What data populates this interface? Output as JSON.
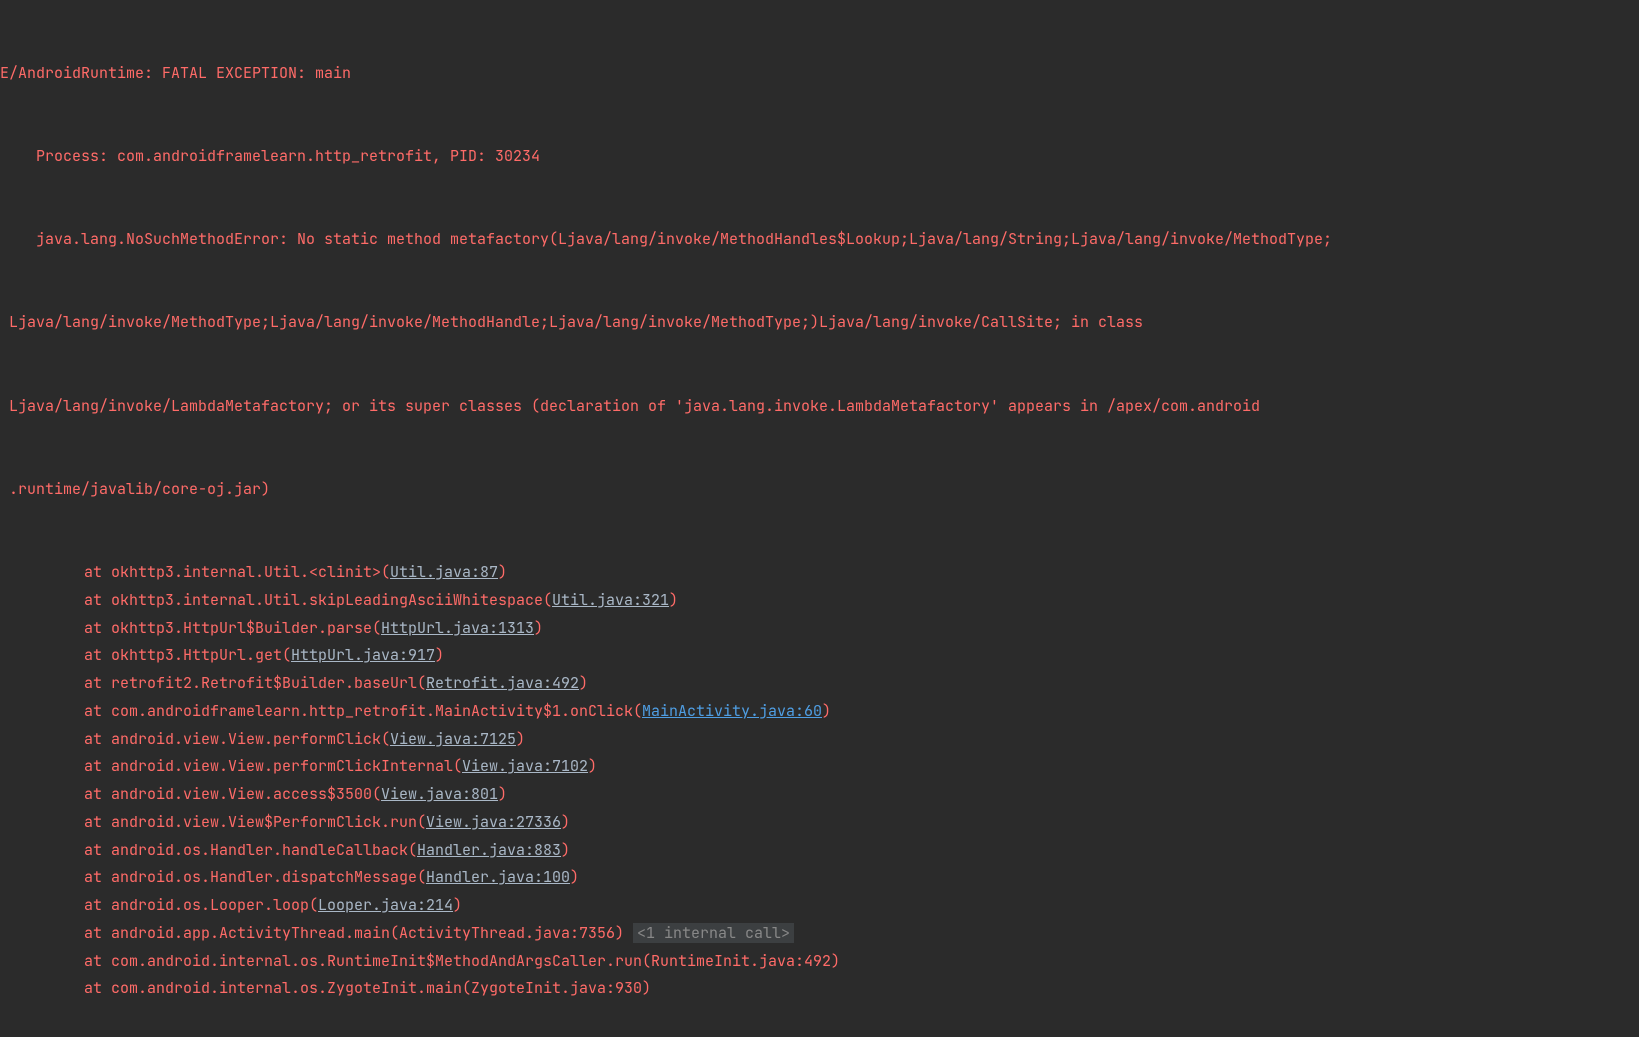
{
  "header": {
    "tag": "E/AndroidRuntime: FATAL EXCEPTION: main",
    "process": "    Process: com.androidframelearn.http_retrofit, PID: 30234",
    "msg1": "    java.lang.NoSuchMethodError: No static method metafactory(Ljava/lang/invoke/MethodHandles$Lookup;Ljava/lang/String;Ljava/lang/invoke/MethodType;",
    "msg2": " Ljava/lang/invoke/MethodType;Ljava/lang/invoke/MethodHandle;Ljava/lang/invoke/MethodType;)Ljava/lang/invoke/CallSite; in class ",
    "msg3": " Ljava/lang/invoke/LambdaMetafactory; or its super classes (declaration of 'java.lang.invoke.LambdaMetafactory' appears in /apex/com.android",
    "msg4": " .runtime/javalib/core-oj.jar)"
  },
  "frames": [
    {
      "pre": "at okhttp3.internal.Util.<clinit>(",
      "link": "Util.java:87",
      "post": ")",
      "type": "lnk"
    },
    {
      "pre": "at okhttp3.internal.Util.skipLeadingAsciiWhitespace(",
      "link": "Util.java:321",
      "post": ")",
      "type": "lnk"
    },
    {
      "pre": "at okhttp3.HttpUrl$Builder.parse(",
      "link": "HttpUrl.java:1313",
      "post": ")",
      "type": "lnk"
    },
    {
      "pre": "at okhttp3.HttpUrl.get(",
      "link": "HttpUrl.java:917",
      "post": ")",
      "type": "lnk"
    },
    {
      "pre": "at retrofit2.Retrofit$Builder.baseUrl(",
      "link": "Retrofit.java:492",
      "post": ")",
      "type": "lnk"
    },
    {
      "pre": "at com.androidframelearn.http_retrofit.MainActivity$1.onClick(",
      "link": "MainActivity.java:60",
      "post": ")",
      "type": "lnk-blue"
    },
    {
      "pre": "at android.view.View.performClick(",
      "link": "View.java:7125",
      "post": ")",
      "type": "lnk"
    },
    {
      "pre": "at android.view.View.performClickInternal(",
      "link": "View.java:7102",
      "post": ")",
      "type": "lnk"
    },
    {
      "pre": "at android.view.View.access$3500(",
      "link": "View.java:801",
      "post": ")",
      "type": "lnk"
    },
    {
      "pre": "at android.view.View$PerformClick.run(",
      "link": "View.java:27336",
      "post": ")",
      "type": "lnk"
    },
    {
      "pre": "at android.os.Handler.handleCallback(",
      "link": "Handler.java:883",
      "post": ")",
      "type": "lnk"
    },
    {
      "pre": "at android.os.Handler.dispatchMessage(",
      "link": "Handler.java:100",
      "post": ")",
      "type": "lnk"
    },
    {
      "pre": "at android.os.Looper.loop(",
      "link": "Looper.java:214",
      "post": ")",
      "type": "lnk"
    },
    {
      "pre": "at android.app.ActivityThread.main(ActivityThread.java:7356)",
      "link": "",
      "post": "",
      "type": "none",
      "fold": "<1 internal call>"
    },
    {
      "pre": "at com.android.internal.os.RuntimeInit$MethodAndArgsCaller.run(RuntimeInit.java:492)",
      "link": "",
      "post": "",
      "type": "none"
    },
    {
      "pre": "at com.android.internal.os.ZygoteInit.main(ZygoteInit.java:930)",
      "link": "",
      "post": "",
      "type": "none"
    }
  ]
}
